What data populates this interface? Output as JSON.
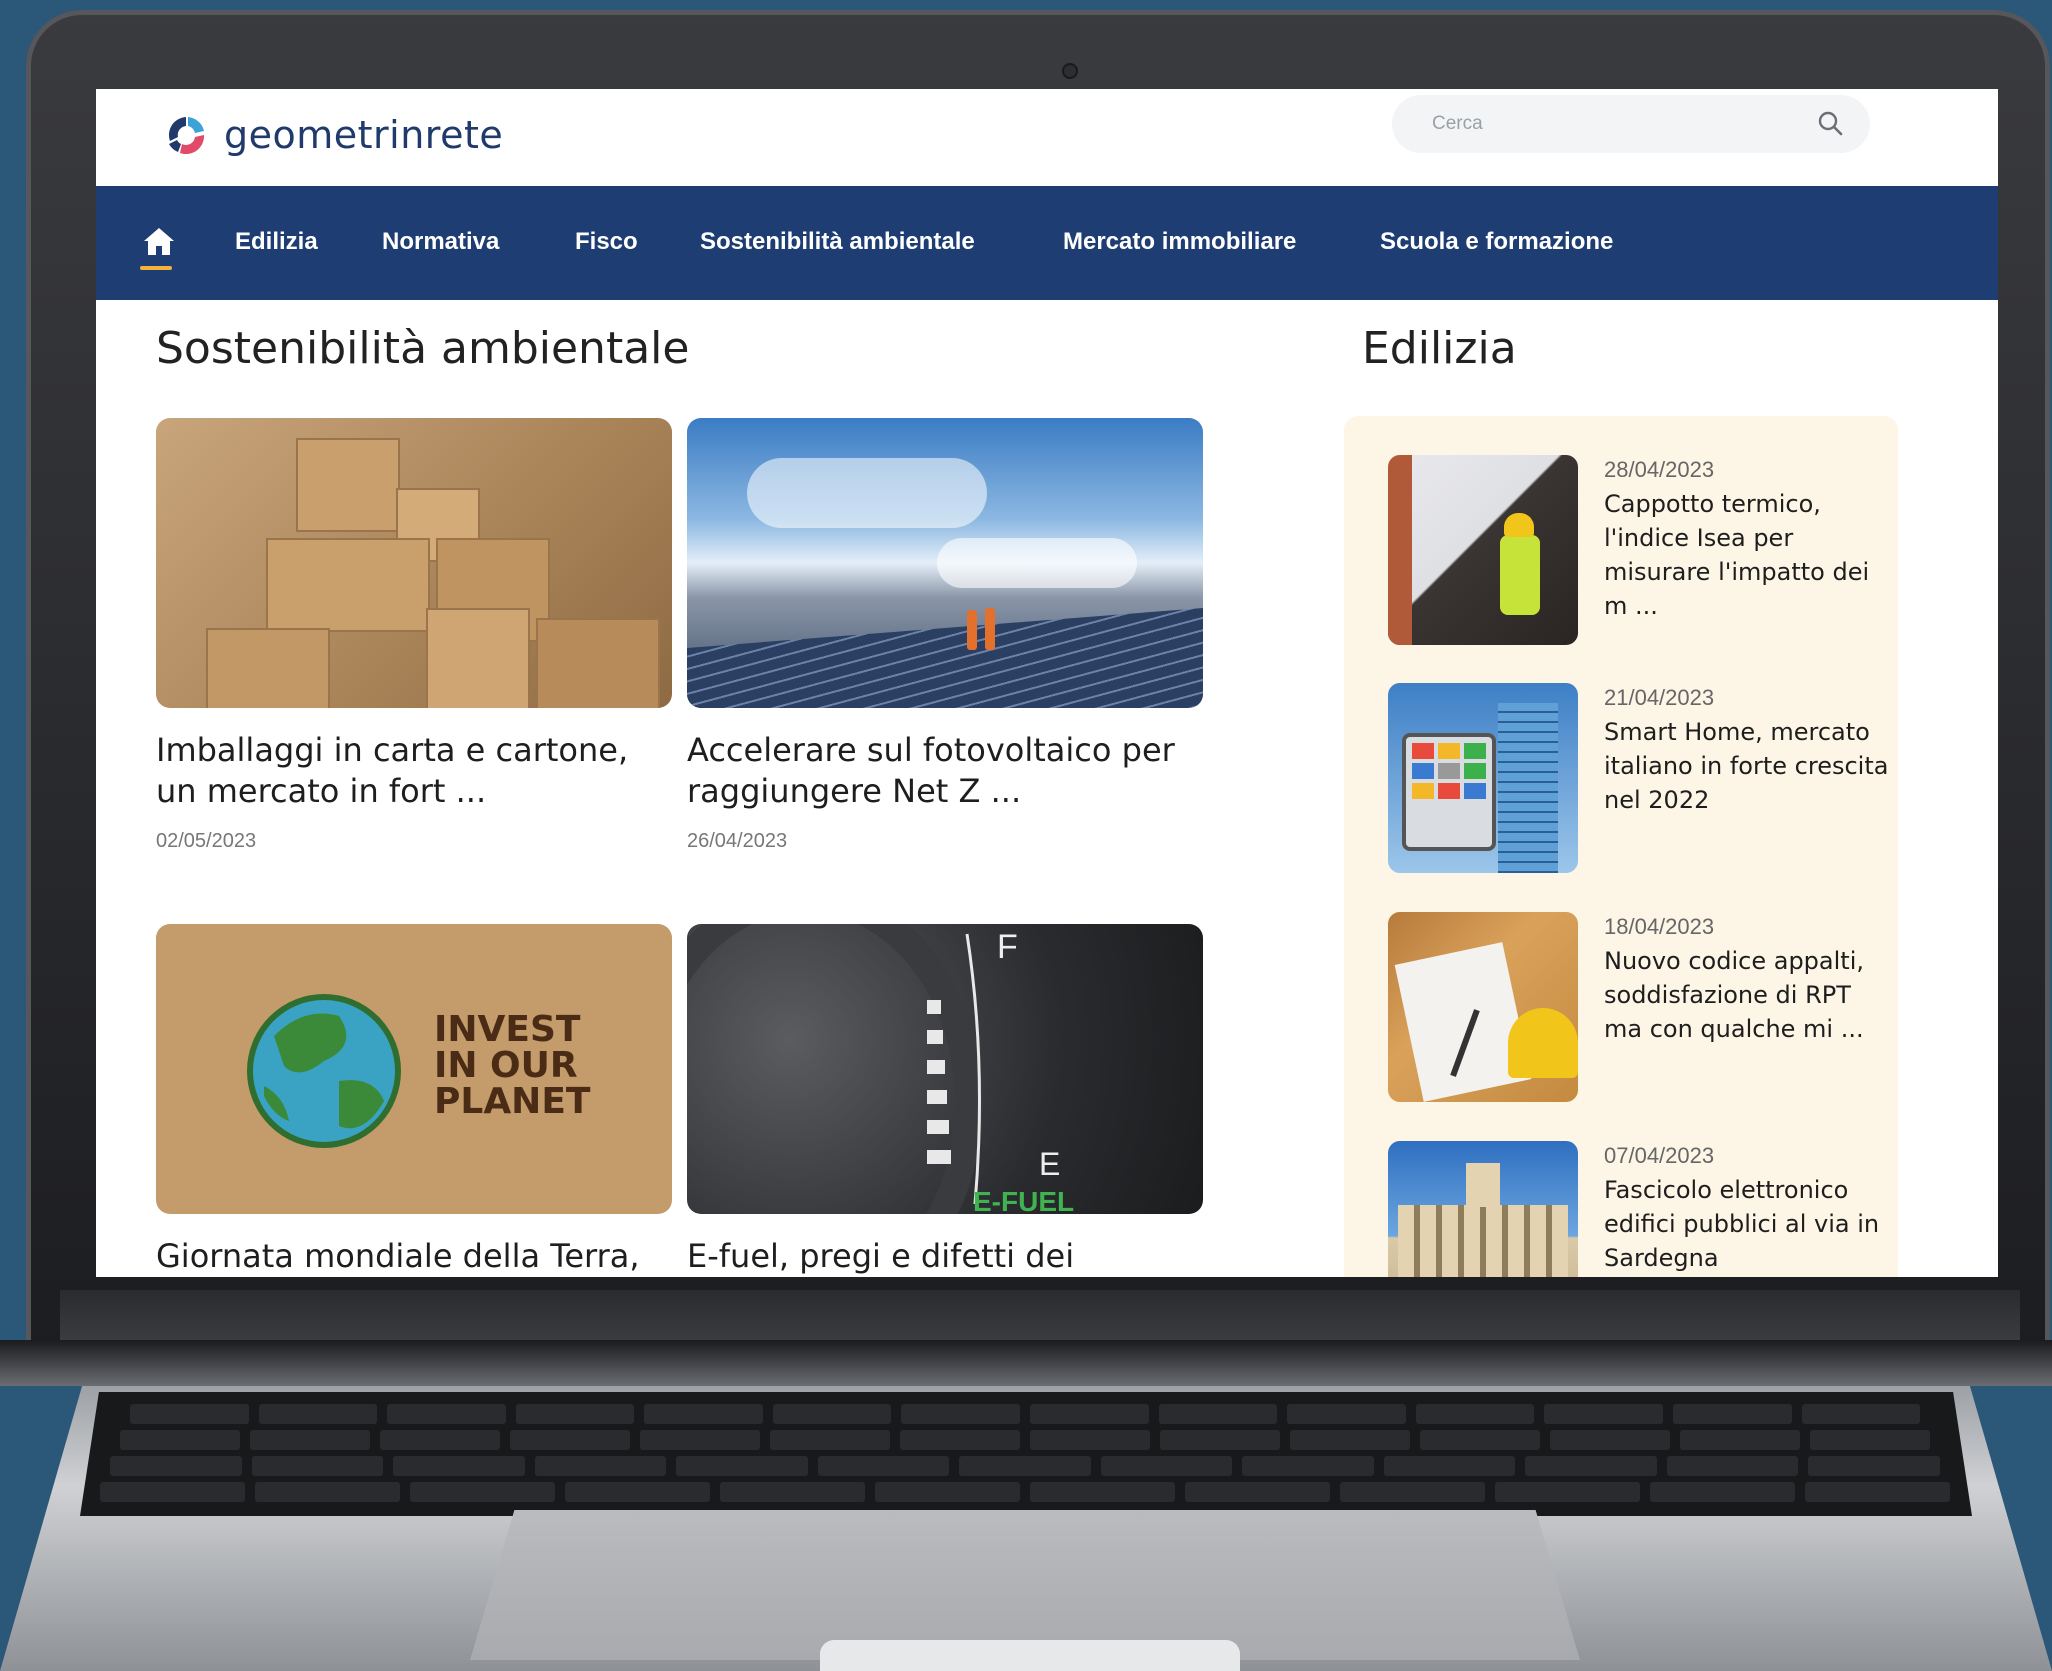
{
  "site": {
    "brand": "geometrinrete",
    "search_placeholder": "Cerca"
  },
  "nav": {
    "items": [
      "Edilizia",
      "Normativa",
      "Fisco",
      "Sostenibilità ambientale",
      "Mercato immobiliare",
      "Scuola e formazione"
    ]
  },
  "main": {
    "section_title": "Sostenibilità ambientale",
    "cards": [
      {
        "title_line1": "Imballaggi in carta e cartone,",
        "title_line2": "un mercato in fort ...",
        "date": "02/05/2023",
        "image": "cardboard-boxes"
      },
      {
        "title_line1": "Accelerare sul fotovoltaico per",
        "title_line2": "raggiungere Net Z ...",
        "date": "26/04/2023",
        "image": "solar-panels"
      },
      {
        "title_line1": "Giornata mondiale della Terra,",
        "title_line2": "",
        "date": "",
        "image": "invest-in-our-planet",
        "image_text": [
          "INVEST",
          "IN OUR",
          "PLANET"
        ]
      },
      {
        "title_line1": "E-fuel, pregi e difetti dei",
        "title_line2": "",
        "date": "",
        "image": "fuel-gauge",
        "image_text": [
          "F",
          "E",
          "E-FUEL"
        ]
      }
    ]
  },
  "aside": {
    "section_title": "Edilizia",
    "items": [
      {
        "date": "28/04/2023",
        "title": "Cappotto termico, l'indice Isea per misurare l'impatto dei m ..."
      },
      {
        "date": "21/04/2023",
        "title": "Smart Home, mercato italiano in forte crescita nel 2022"
      },
      {
        "date": "18/04/2023",
        "title": "Nuovo codice appalti, soddisfazione di RPT ma con qualche mi ..."
      },
      {
        "date": "07/04/2023",
        "title": "Fascicolo elettronico edifici pubblici al via in Sardegna"
      }
    ]
  },
  "colors": {
    "nav_bg": "#1e3d73",
    "accent": "#f2b23b",
    "aside_bg": "#fdf5e6",
    "page_bg": "#2b5878"
  }
}
